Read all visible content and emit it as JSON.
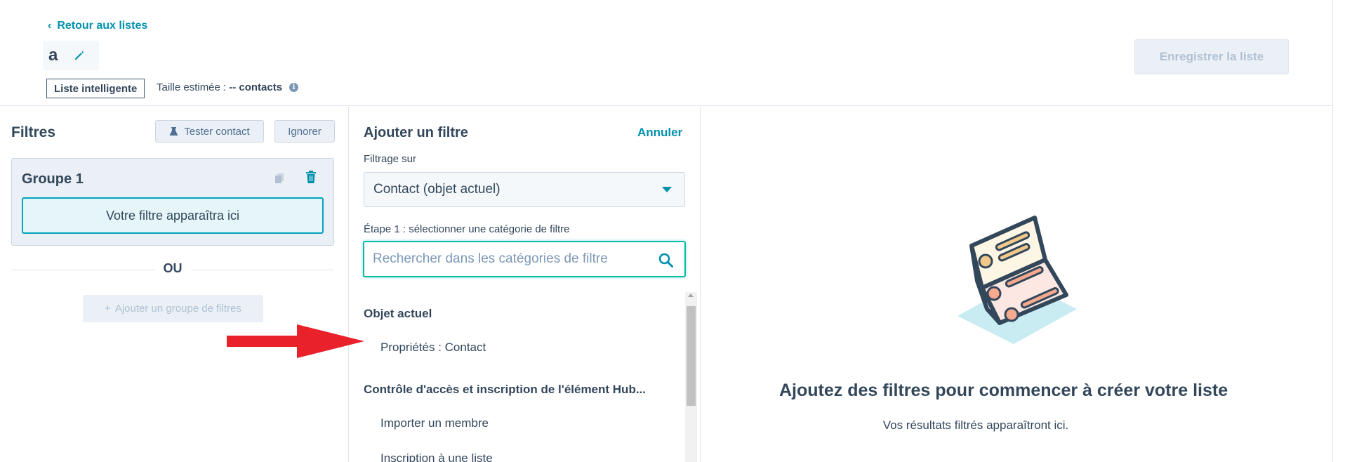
{
  "header": {
    "back_link": "Retour aux listes",
    "list_name": "a",
    "save_button": "Enregistrer la liste",
    "list_type_badge": "Liste intelligente",
    "size_label": "Taille estimée :",
    "size_value": "-- contacts",
    "info_icon": "info-icon"
  },
  "left_panel": {
    "title": "Filtres",
    "test_contact_button": "Tester contact",
    "ignore_button": "Ignorer",
    "group": {
      "title": "Groupe 1",
      "placeholder": "Votre filtre apparaîtra ici"
    },
    "or_label": "OU",
    "add_group_button": "Ajouter un groupe de filtres"
  },
  "middle_panel": {
    "title": "Ajouter un filtre",
    "cancel_link": "Annuler",
    "filtering_label": "Filtrage sur",
    "filtering_value": "Contact (objet actuel)",
    "step_label": "Étape 1 : sélectionner une catégorie de filtre",
    "search_placeholder": "Rechercher dans les catégories de filtre",
    "sections": [
      {
        "title": "Objet actuel",
        "items": [
          "Propriétés : Contact"
        ]
      },
      {
        "title": "Contrôle d'accès et inscription de l'élément Hub...",
        "items": [
          "Importer un membre",
          "Inscription à une liste"
        ]
      }
    ]
  },
  "right_panel": {
    "empty_title": "Ajoutez des filtres pour commencer à créer votre liste",
    "empty_subtitle": "Vos résultats filtrés apparaîtront ici."
  },
  "colors": {
    "accent": "#0091ae",
    "text": "#33475b",
    "annotation_arrow": "#e8212b"
  }
}
